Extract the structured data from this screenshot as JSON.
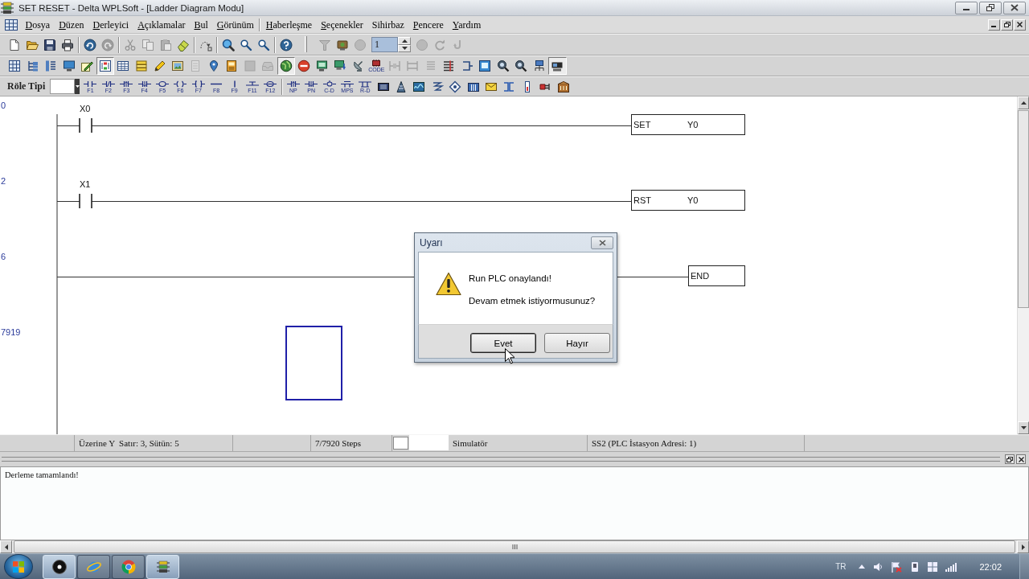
{
  "window": {
    "title": "SET RESET - Delta WPLSoft - [Ladder Diagram Modu]"
  },
  "menu": [
    {
      "kind": "item",
      "label": "Dosya",
      "mnemonic": true
    },
    {
      "kind": "item",
      "label": "Düzen",
      "mnemonic": true
    },
    {
      "kind": "item",
      "label": "Derleyici",
      "mnemonic": true
    },
    {
      "kind": "item",
      "label": "Açıklamalar",
      "mnemonic": true
    },
    {
      "kind": "item",
      "label": "Bul",
      "mnemonic": true
    },
    {
      "kind": "item",
      "label": "Görünüm",
      "mnemonic": true
    },
    {
      "kind": "separator"
    },
    {
      "kind": "item",
      "label": "Haberleşme",
      "mnemonic": true
    },
    {
      "kind": "item",
      "label": "Seçenekler",
      "mnemonic": true
    },
    {
      "kind": "item",
      "label": "Sihirbaz",
      "mnemonic": false
    },
    {
      "kind": "item",
      "label": "Pencere",
      "mnemonic": true
    },
    {
      "kind": "item",
      "label": "Yardım",
      "mnemonic": true
    }
  ],
  "toolbars": [
    {
      "items": [
        {
          "kind": "button",
          "disabled": false
        },
        {
          "kind": "button",
          "disabled": false
        },
        {
          "kind": "button",
          "disabled": false
        },
        {
          "kind": "button",
          "disabled": false
        },
        {
          "kind": "separator"
        },
        {
          "kind": "button",
          "disabled": false
        },
        {
          "kind": "button",
          "disabled": true
        },
        {
          "kind": "separator"
        },
        {
          "kind": "button",
          "disabled": true
        },
        {
          "kind": "button",
          "disabled": true
        },
        {
          "kind": "button",
          "disabled": true
        },
        {
          "kind": "button",
          "disabled": false
        },
        {
          "kind": "separator"
        },
        {
          "kind": "button",
          "disabled": false
        },
        {
          "kind": "separator"
        },
        {
          "kind": "button",
          "disabled": false
        },
        {
          "kind": "button",
          "disabled": false
        },
        {
          "kind": "button",
          "disabled": false
        },
        {
          "kind": "separator"
        },
        {
          "kind": "button",
          "disabled": false
        },
        {
          "kind": "grip"
        },
        {
          "kind": "button",
          "disabled": true
        },
        {
          "kind": "button",
          "disabled": false
        },
        {
          "kind": "button",
          "disabled": true
        },
        {
          "kind": "spin",
          "value": "1"
        },
        {
          "kind": "button",
          "disabled": true
        },
        {
          "kind": "button",
          "disabled": true
        },
        {
          "kind": "button",
          "disabled": true
        }
      ]
    },
    {
      "items": [
        {
          "kind": "button",
          "disabled": false,
          "pressed": false
        },
        {
          "kind": "button",
          "disabled": false,
          "pressed": false
        },
        {
          "kind": "button",
          "disabled": false,
          "pressed": false
        },
        {
          "kind": "button",
          "disabled": false,
          "pressed": false
        },
        {
          "kind": "button",
          "disabled": false,
          "pressed": false
        },
        {
          "kind": "button",
          "disabled": false,
          "pressed": true
        },
        {
          "kind": "button",
          "disabled": false,
          "pressed": false
        },
        {
          "kind": "button",
          "disabled": false,
          "pressed": false
        },
        {
          "kind": "button",
          "disabled": false,
          "pressed": false
        },
        {
          "kind": "button",
          "disabled": false,
          "pressed": false
        },
        {
          "kind": "button",
          "disabled": true,
          "pressed": false
        },
        {
          "kind": "button",
          "disabled": false,
          "pressed": false
        },
        {
          "kind": "button",
          "disabled": false,
          "pressed": false
        },
        {
          "kind": "button",
          "disabled": true,
          "pressed": false
        },
        {
          "kind": "button",
          "disabled": true,
          "pressed": false
        },
        {
          "kind": "button",
          "disabled": false,
          "pressed": true
        },
        {
          "kind": "button",
          "disabled": false,
          "pressed": false
        },
        {
          "kind": "button",
          "disabled": false,
          "pressed": false
        },
        {
          "kind": "button",
          "disabled": false,
          "pressed": false
        },
        {
          "kind": "button",
          "disabled": false,
          "pressed": false
        },
        {
          "kind": "button",
          "label": "CODE",
          "disabled": false,
          "pressed": false
        },
        {
          "kind": "button",
          "disabled": true,
          "pressed": false
        },
        {
          "kind": "button",
          "disabled": true,
          "pressed": false
        },
        {
          "kind": "button",
          "disabled": true,
          "pressed": false
        },
        {
          "kind": "button",
          "disabled": false,
          "pressed": false
        },
        {
          "kind": "button",
          "disabled": false,
          "pressed": false
        },
        {
          "kind": "button",
          "disabled": false,
          "pressed": false
        },
        {
          "kind": "button",
          "disabled": false,
          "pressed": false
        },
        {
          "kind": "button",
          "disabled": false,
          "pressed": false
        },
        {
          "kind": "button",
          "disabled": false,
          "pressed": false
        },
        {
          "kind": "button",
          "disabled": false,
          "pressed": true
        }
      ]
    },
    {
      "items": [
        {
          "kind": "label",
          "text": "Röle Tipi"
        },
        {
          "kind": "combo"
        },
        {
          "kind": "button",
          "label": "F1"
        },
        {
          "kind": "button",
          "label": "F2"
        },
        {
          "kind": "button",
          "label": "F3"
        },
        {
          "kind": "button",
          "label": "F4"
        },
        {
          "kind": "button",
          "label": "F5"
        },
        {
          "kind": "button",
          "label": "F6"
        },
        {
          "kind": "button",
          "label": "F7"
        },
        {
          "kind": "button",
          "label": "F8"
        },
        {
          "kind": "button",
          "label": "F9"
        },
        {
          "kind": "button",
          "label": "F11"
        },
        {
          "kind": "button",
          "label": "F12"
        },
        {
          "kind": "separator"
        },
        {
          "kind": "button",
          "label": "NP"
        },
        {
          "kind": "button",
          "label": "PN"
        },
        {
          "kind": "button",
          "label": "C-D"
        },
        {
          "kind": "button",
          "label": "MPS"
        },
        {
          "kind": "button",
          "label": "R-D"
        },
        {
          "kind": "button"
        },
        {
          "kind": "button"
        },
        {
          "kind": "button"
        },
        {
          "kind": "button"
        },
        {
          "kind": "button"
        },
        {
          "kind": "button"
        },
        {
          "kind": "button"
        },
        {
          "kind": "button"
        },
        {
          "kind": "button"
        },
        {
          "kind": "button"
        },
        {
          "kind": "button"
        }
      ]
    }
  ],
  "ladder": {
    "rungs": [
      {
        "step": "0",
        "contacts": [
          {
            "label": "X0"
          }
        ],
        "instruction": {
          "kind": "output",
          "name": "SET",
          "operand": "Y0"
        }
      },
      {
        "step": "2",
        "contacts": [
          {
            "label": "X1"
          }
        ],
        "instruction": {
          "kind": "output",
          "name": "RST",
          "operand": "Y0"
        }
      },
      {
        "step": "6",
        "instruction": {
          "kind": "end",
          "name": "END"
        }
      },
      {
        "step": "7919",
        "cells": [
          {
            "selected": false
          },
          {
            "selected": false
          },
          {
            "selected": false
          },
          {
            "selected": false
          },
          {
            "selected": true
          }
        ]
      }
    ]
  },
  "dialog": {
    "title": "Uyarı",
    "messages": [
      "Run PLC onaylandı!",
      "Devam etmek istiyormusunuz?"
    ],
    "buttons": [
      {
        "label": "Evet",
        "focused": true
      },
      {
        "label": "Hayır",
        "focused": false
      }
    ]
  },
  "status_bar": {
    "mode": "Üzerine Y",
    "position": "Satır: 3, Sütün: 5",
    "steps": "7/7920 Steps",
    "connection": "Simulatör",
    "station": "SS2 (PLC İstasyon Adresi: 1)"
  },
  "output": {
    "messages": [
      "Derleme tamamlandı!"
    ]
  },
  "taskbar": {
    "apps": [
      {
        "selected": true
      },
      {
        "selected": false
      },
      {
        "selected": false
      },
      {
        "selected": true
      }
    ],
    "language": "TR",
    "clock": "22:02"
  }
}
